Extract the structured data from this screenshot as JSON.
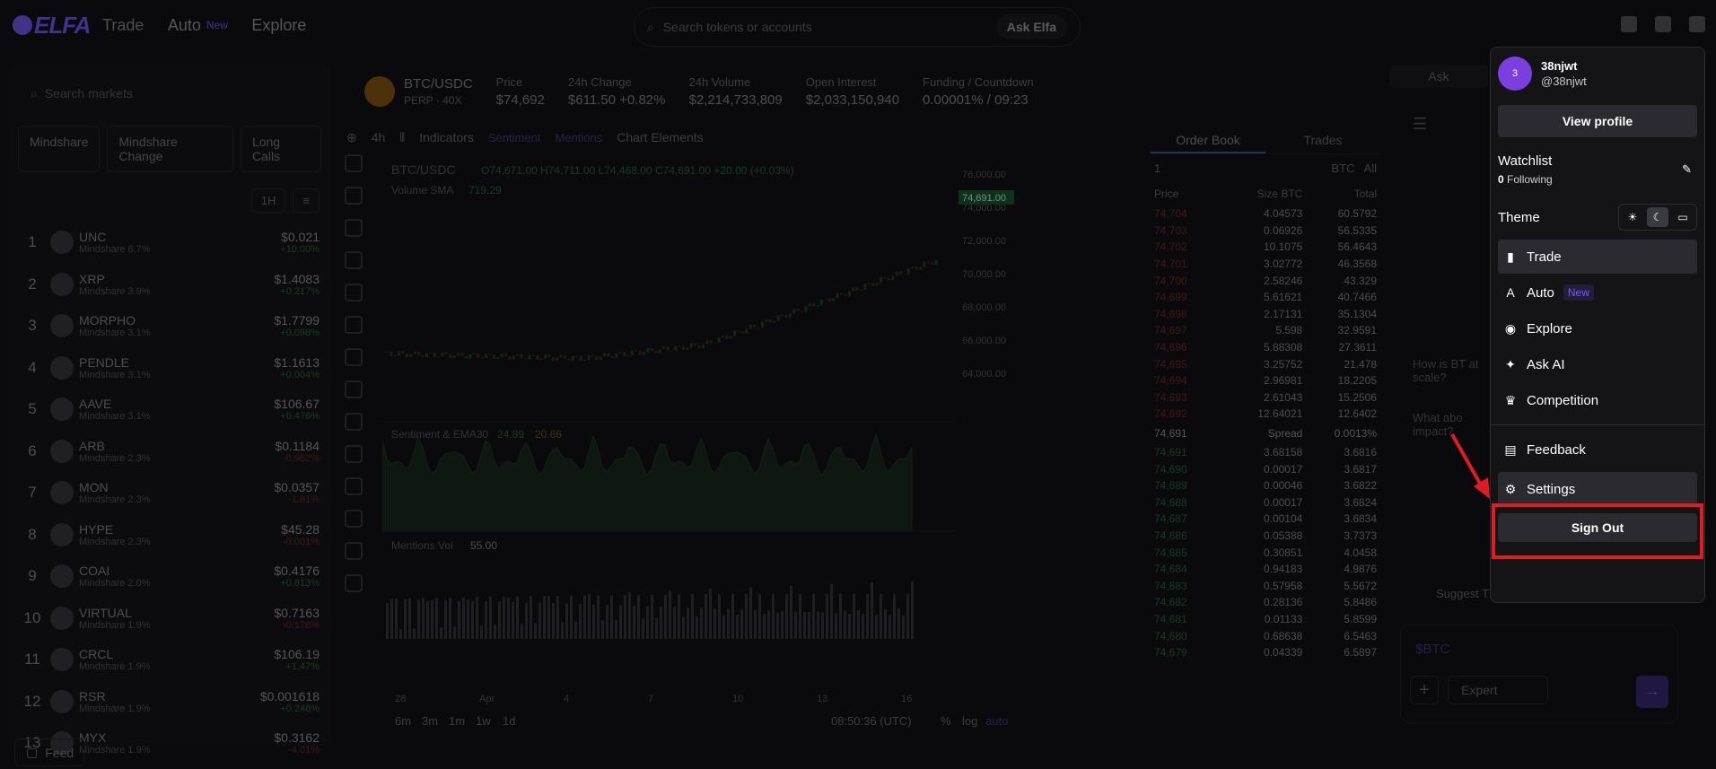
{
  "nav": {
    "trade": "Trade",
    "auto": "Auto",
    "new": "New",
    "explore": "Explore"
  },
  "search": {
    "placeholder": "Search tokens or accounts",
    "ask": "Ask Elfa"
  },
  "markets": {
    "placeholder": "Search markets",
    "filters": [
      "Mindshare",
      "Mindshare Change",
      "Long Calls"
    ],
    "timeframe": "1H",
    "rows": [
      {
        "rank": "1",
        "name": "UNC",
        "sub": "Mindshare 6.7%",
        "price": "$0.021",
        "chg": "+10.00%",
        "dir": "up"
      },
      {
        "rank": "2",
        "name": "XRP",
        "sub": "Mindshare 3.9%",
        "price": "$1.4083",
        "chg": "+0.217%",
        "dir": "up"
      },
      {
        "rank": "3",
        "name": "MORPHO",
        "sub": "Mindshare 3.1%",
        "price": "$1.7799",
        "chg": "+0.098%",
        "dir": "up"
      },
      {
        "rank": "4",
        "name": "PENDLE",
        "sub": "Mindshare 3.1%",
        "price": "$1.1613",
        "chg": "+0.004%",
        "dir": "up"
      },
      {
        "rank": "5",
        "name": "AAVE",
        "sub": "Mindshare 3.1%",
        "price": "$106.67",
        "chg": "+0.476%",
        "dir": "up"
      },
      {
        "rank": "6",
        "name": "ARB",
        "sub": "Mindshare 2.3%",
        "price": "$0.1184",
        "chg": "-0.962%",
        "dir": "dn"
      },
      {
        "rank": "7",
        "name": "MON",
        "sub": "Mindshare 2.3%",
        "price": "$0.0357",
        "chg": "-1.81%",
        "dir": "dn"
      },
      {
        "rank": "8",
        "name": "HYPE",
        "sub": "Mindshare 2.3%",
        "price": "$45.28",
        "chg": "-0.001%",
        "dir": "dn"
      },
      {
        "rank": "9",
        "name": "COAI",
        "sub": "Mindshare 2.0%",
        "price": "$0.4176",
        "chg": "+0.813%",
        "dir": "up"
      },
      {
        "rank": "10",
        "name": "VIRTUAL",
        "sub": "Mindshare 1.9%",
        "price": "$0.7163",
        "chg": "-0.178%",
        "dir": "dn"
      },
      {
        "rank": "11",
        "name": "CRCL",
        "sub": "Mindshare 1.9%",
        "price": "$106.19",
        "chg": "+1.47%",
        "dir": "up"
      },
      {
        "rank": "12",
        "name": "RSR",
        "sub": "Mindshare 1.9%",
        "price": "$0.001618",
        "chg": "+0.248%",
        "dir": "up"
      },
      {
        "rank": "13",
        "name": "MYX",
        "sub": "Mindshare 1.9%",
        "price": "$0.3162",
        "chg": "-4.01%",
        "dir": "dn"
      }
    ]
  },
  "feed": "Feed",
  "pair": {
    "name": "BTC/USDC",
    "sub": "PERP · 40X",
    "lev": "x40",
    "stats": [
      {
        "k": "Price",
        "v": "$74,692"
      },
      {
        "k": "24h Change",
        "v": "$611.50 +0.82%"
      },
      {
        "k": "24h Volume",
        "v": "$2,214,733,809"
      },
      {
        "k": "Open Interest",
        "v": "$2,033,150,940"
      },
      {
        "k": "Funding / Countdown",
        "v": "0.00001% / 09:23"
      }
    ]
  },
  "toolbar": {
    "interval": "4h",
    "indicators": "Indicators",
    "sentiment": "Sentiment",
    "mentions": "Mentions",
    "elements": "Chart Elements"
  },
  "chart": {
    "legend": "BTC/USDC",
    "ohlc": "O74,671.00 H74,711.00 L74,468.00 C74,691.00 +20.00 (+0.03%)",
    "vol": "Volume SMA",
    "volv": "719.29",
    "sent": "Sentiment & EMA30",
    "sentv1": "24.89",
    "sentv2": "20.66",
    "ment": "Mentions Vol",
    "mentv": "55.00",
    "last": "74,691.00",
    "yticks": [
      "76,000.00",
      "74,000.00",
      "72,000.00",
      "70,000.00",
      "68,000.00",
      "66,000.00",
      "64,000.00"
    ],
    "xticks": [
      "28",
      "Apr",
      "4",
      "7",
      "10",
      "13",
      "16"
    ],
    "ranges": [
      "6m",
      "3m",
      "1m",
      "1w",
      "1d"
    ],
    "clock": "08:50:36 (UTC)",
    "pct": "%",
    "log": "log",
    "auto": "auto"
  },
  "orderbook": {
    "tabs": [
      "Order Book",
      "Trades"
    ],
    "size": "1",
    "unit": "BTC",
    "filter": "All",
    "cols": [
      "Price",
      "Size BTC",
      "Total"
    ],
    "asks": [
      [
        "74,704",
        "4.04573",
        "60.5792"
      ],
      [
        "74,703",
        "0.06926",
        "56.5335"
      ],
      [
        "74,702",
        "10.1075",
        "56.4643"
      ],
      [
        "74,701",
        "3.02772",
        "46.3568"
      ],
      [
        "74,700",
        "2.58246",
        "43.329"
      ],
      [
        "74,699",
        "5.61621",
        "40.7466"
      ],
      [
        "74,698",
        "2.17131",
        "35.1304"
      ],
      [
        "74,697",
        "5.598",
        "32.9591"
      ],
      [
        "74,696",
        "5.88308",
        "27.3611"
      ],
      [
        "74,695",
        "3.25752",
        "21.478"
      ],
      [
        "74,694",
        "2.96981",
        "18.2205"
      ],
      [
        "74,693",
        "2.61043",
        "15.2506"
      ],
      [
        "74,692",
        "12.64021",
        "12.6402"
      ]
    ],
    "spread": [
      "74,691",
      "Spread",
      "0.0013%"
    ],
    "bids": [
      [
        "74,691",
        "3.68158",
        "3.6816"
      ],
      [
        "74,690",
        "0.00017",
        "3.6817"
      ],
      [
        "74,689",
        "0.00046",
        "3.6822"
      ],
      [
        "74,688",
        "0.00017",
        "3.6824"
      ],
      [
        "74,687",
        "0.00104",
        "3.6834"
      ],
      [
        "74,686",
        "0.05388",
        "3.7373"
      ],
      [
        "74,685",
        "0.30851",
        "4.0458"
      ],
      [
        "74,684",
        "0.94183",
        "4.9876"
      ],
      [
        "74,683",
        "0.57958",
        "5.5672"
      ],
      [
        "74,682",
        "0.28136",
        "5.8486"
      ],
      [
        "74,681",
        "0.01133",
        "5.8599"
      ],
      [
        "74,680",
        "0.68638",
        "6.5463"
      ],
      [
        "74,679",
        "0.04339",
        "6.5897"
      ]
    ]
  },
  "assistant": {
    "ask": "Ask",
    "q1": "How is BT at scale?",
    "q2": "What abo impact?",
    "suggest": "Suggest T",
    "token": "$BTC",
    "mode": "Expert"
  },
  "menu": {
    "avatar": "3",
    "name": "38njwt",
    "handle": "@38njwt",
    "view": "View profile",
    "watchlist": "Watchlist",
    "following_n": "0",
    "following": "Following",
    "theme": "Theme",
    "items": [
      {
        "label": "Trade",
        "icon": "▮"
      },
      {
        "label": "Auto",
        "icon": "A",
        "badge": "New"
      },
      {
        "label": "Explore",
        "icon": "◉"
      },
      {
        "label": "Ask AI",
        "icon": "✦"
      },
      {
        "label": "Competition",
        "icon": "♛"
      }
    ],
    "feedback": "Feedback",
    "settings": "Settings",
    "signout": "Sign Out"
  }
}
